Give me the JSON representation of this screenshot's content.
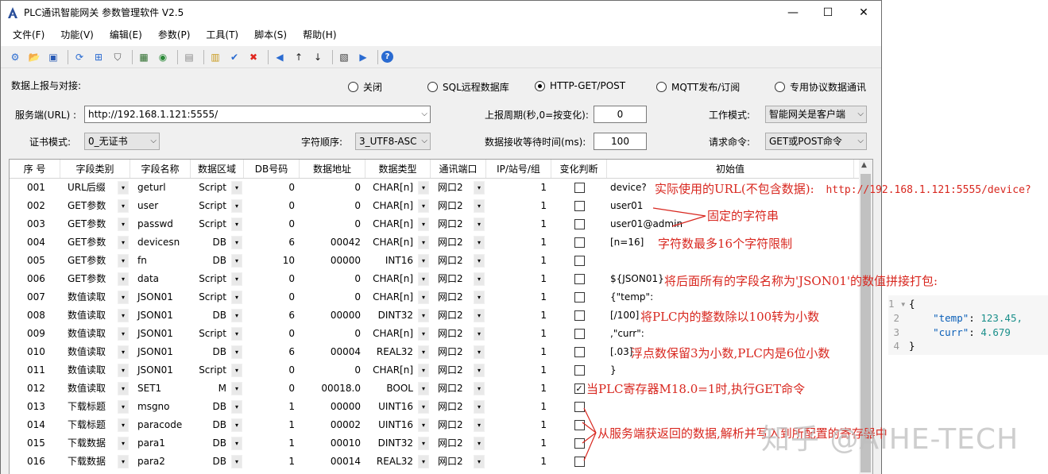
{
  "window": {
    "title": "PLC通讯智能网关 参数管理软件 V2.5",
    "controls": {
      "min": "—",
      "max": "☐",
      "close": "✕"
    }
  },
  "menu": [
    "文件(F)",
    "功能(V)",
    "编辑(E)",
    "参数(P)",
    "工具(T)",
    "脚本(S)",
    "帮助(H)"
  ],
  "toolbar": [
    {
      "icon": "device-config-icon",
      "glyph": "⚙",
      "color": "#2a6bd1"
    },
    {
      "icon": "open-folder-icon",
      "glyph": "📂",
      "color": "#d69a1a"
    },
    {
      "icon": "save-disk-icon",
      "glyph": "▣",
      "color": "#2a5bb5"
    },
    {
      "sep": true
    },
    {
      "icon": "refresh-icon",
      "glyph": "⟳",
      "color": "#2a6bd1"
    },
    {
      "icon": "network-tree-icon",
      "glyph": "⊞",
      "color": "#2a6bd1"
    },
    {
      "icon": "shield-icon",
      "glyph": "⛉",
      "color": "#555"
    },
    {
      "sep": true
    },
    {
      "icon": "monitor-icon",
      "glyph": "▦",
      "color": "#2d6d2d"
    },
    {
      "icon": "globe-icon",
      "glyph": "◉",
      "color": "#2d8b3a"
    },
    {
      "sep": true
    },
    {
      "icon": "table-icon",
      "glyph": "▤",
      "color": "#888"
    },
    {
      "sep": true
    },
    {
      "icon": "paste-icon",
      "glyph": "▥",
      "color": "#c99a1c"
    },
    {
      "icon": "check-icon",
      "glyph": "✔",
      "color": "#2a6bd1"
    },
    {
      "icon": "delete-x-icon",
      "glyph": "✖",
      "color": "#e0261f"
    },
    {
      "sep": true
    },
    {
      "icon": "arrow-left-icon",
      "glyph": "◀",
      "color": "#2a6bd1"
    },
    {
      "icon": "arrow-up-icon",
      "glyph": "↑",
      "color": "#222"
    },
    {
      "icon": "arrow-down-icon",
      "glyph": "↓",
      "color": "#222"
    },
    {
      "sep": true
    },
    {
      "icon": "dc-meter-icon",
      "glyph": "▧",
      "color": "#333"
    },
    {
      "icon": "play-right-icon",
      "glyph": "▶",
      "color": "#2a6bd1"
    },
    {
      "sep": true
    },
    {
      "icon": "help-circle-icon",
      "glyph": "?",
      "color": "#2a6bd1"
    }
  ],
  "report": {
    "label": "数据上报与对接:",
    "options": [
      {
        "label": "关闭",
        "selected": false
      },
      {
        "label": "SQL远程数据库",
        "selected": false
      },
      {
        "label": "HTTP-GET/POST",
        "selected": true
      },
      {
        "label": "MQTT发布/订阅",
        "selected": false
      },
      {
        "label": "专用协议数据通讯",
        "selected": false
      }
    ]
  },
  "form": {
    "server_label": "服务端(URL) :",
    "server_url": "http://192.168.1.121:5555/",
    "period_label": "上报周期(秒,0=按变化):",
    "period_value": "0",
    "work_mode_label": "工作模式:",
    "work_mode_value": "智能网关是客户端",
    "cert_label": "证书模式:",
    "cert_value": "0_无证书",
    "charset_label": "字符顺序:",
    "charset_value": "3_UTF8-ASC",
    "timeout_label": "数据接收等待时间(ms):",
    "timeout_value": "100",
    "request_label": "请求命令:",
    "request_value": "GET或POST命令"
  },
  "table": {
    "headers": [
      "序 号",
      "字段类别",
      "字段名称",
      "数据区域",
      "DB号码",
      "数据地址",
      "数据类型",
      "通讯端口",
      "IP/站号/组",
      "变化判断",
      "初始值"
    ],
    "rows": [
      {
        "no": "001",
        "cat": "URL后缀",
        "name": "geturl",
        "area": "Script",
        "db": "0",
        "addr": "0",
        "type": "CHAR[n]",
        "port": "网口2",
        "ip": "1",
        "chk": false,
        "init": "device?"
      },
      {
        "no": "002",
        "cat": "GET参数",
        "name": "user",
        "area": "Script",
        "db": "0",
        "addr": "0",
        "type": "CHAR[n]",
        "port": "网口2",
        "ip": "1",
        "chk": false,
        "init": "user01"
      },
      {
        "no": "003",
        "cat": "GET参数",
        "name": "passwd",
        "area": "Script",
        "db": "0",
        "addr": "0",
        "type": "CHAR[n]",
        "port": "网口2",
        "ip": "1",
        "chk": false,
        "init": "user01@admin"
      },
      {
        "no": "004",
        "cat": "GET参数",
        "name": "devicesn",
        "area": "DB",
        "db": "6",
        "addr": "00042",
        "type": "CHAR[n]",
        "port": "网口2",
        "ip": "1",
        "chk": false,
        "init": "[n=16]"
      },
      {
        "no": "005",
        "cat": "GET参数",
        "name": "fn",
        "area": "DB",
        "db": "10",
        "addr": "00000",
        "type": "INT16",
        "port": "网口2",
        "ip": "1",
        "chk": false,
        "init": ""
      },
      {
        "no": "006",
        "cat": "GET参数",
        "name": "data",
        "area": "Script",
        "db": "0",
        "addr": "0",
        "type": "CHAR[n]",
        "port": "网口2",
        "ip": "1",
        "chk": false,
        "init": "${JSON01}"
      },
      {
        "no": "007",
        "cat": "数值读取",
        "name": "JSON01",
        "area": "Script",
        "db": "0",
        "addr": "0",
        "type": "CHAR[n]",
        "port": "网口2",
        "ip": "1",
        "chk": false,
        "init": "{\"temp\":"
      },
      {
        "no": "008",
        "cat": "数值读取",
        "name": "JSON01",
        "area": "DB",
        "db": "6",
        "addr": "00000",
        "type": "DINT32",
        "port": "网口2",
        "ip": "1",
        "chk": false,
        "init": "[/100]"
      },
      {
        "no": "009",
        "cat": "数值读取",
        "name": "JSON01",
        "area": "Script",
        "db": "0",
        "addr": "0",
        "type": "CHAR[n]",
        "port": "网口2",
        "ip": "1",
        "chk": false,
        "init": ",\"curr\":"
      },
      {
        "no": "010",
        "cat": "数值读取",
        "name": "JSON01",
        "area": "DB",
        "db": "6",
        "addr": "00004",
        "type": "REAL32",
        "port": "网口2",
        "ip": "1",
        "chk": false,
        "init": "[.03]"
      },
      {
        "no": "011",
        "cat": "数值读取",
        "name": "JSON01",
        "area": "Script",
        "db": "0",
        "addr": "0",
        "type": "CHAR[n]",
        "port": "网口2",
        "ip": "1",
        "chk": false,
        "init": "}"
      },
      {
        "no": "012",
        "cat": "数值读取",
        "name": "SET1",
        "area": "M",
        "db": "0",
        "addr": "00018.0",
        "type": "BOOL",
        "port": "网口2",
        "ip": "1",
        "chk": true,
        "init": ""
      },
      {
        "no": "013",
        "cat": "下载标题",
        "name": "msgno",
        "area": "DB",
        "db": "1",
        "addr": "00000",
        "type": "UINT16",
        "port": "网口2",
        "ip": "1",
        "chk": false,
        "init": ""
      },
      {
        "no": "014",
        "cat": "下载标题",
        "name": "paracode",
        "area": "DB",
        "db": "1",
        "addr": "00002",
        "type": "UINT16",
        "port": "网口2",
        "ip": "1",
        "chk": false,
        "init": ""
      },
      {
        "no": "015",
        "cat": "下载数据",
        "name": "para1",
        "area": "DB",
        "db": "1",
        "addr": "00010",
        "type": "DINT32",
        "port": "网口2",
        "ip": "1",
        "chk": false,
        "init": ""
      },
      {
        "no": "016",
        "cat": "下载数据",
        "name": "para2",
        "area": "DB",
        "db": "1",
        "addr": "00014",
        "type": "REAL32",
        "port": "网口2",
        "ip": "1",
        "chk": false,
        "init": ""
      }
    ]
  },
  "annotations": {
    "a1": "实际使用的URL(不包含数据):",
    "a1_url": "http://192.168.1.121:5555/device?",
    "a2": "固定的字符串",
    "a3": "字符数最多16个字符限制",
    "a4": "将后面所有的字段名称为'JSON01'的数值拼接打包:",
    "a5": "将PLC内的整数除以100转为小数",
    "a6": "浮点数保留3为小数,PLC内是6位小数",
    "a7": "当PLC寄存器M18.0=1时,执行GET命令",
    "a8": "从服务端获返回的数据,解析并写入到所配置的寄存器中"
  },
  "code": {
    "l1": "{",
    "l2_key": "\"temp\"",
    "l2_val": "123.45,",
    "l3_key": "\"curr\"",
    "l3_val": "4.679",
    "l4": "}"
  },
  "watermark": "知乎 @AIHE-TECH"
}
